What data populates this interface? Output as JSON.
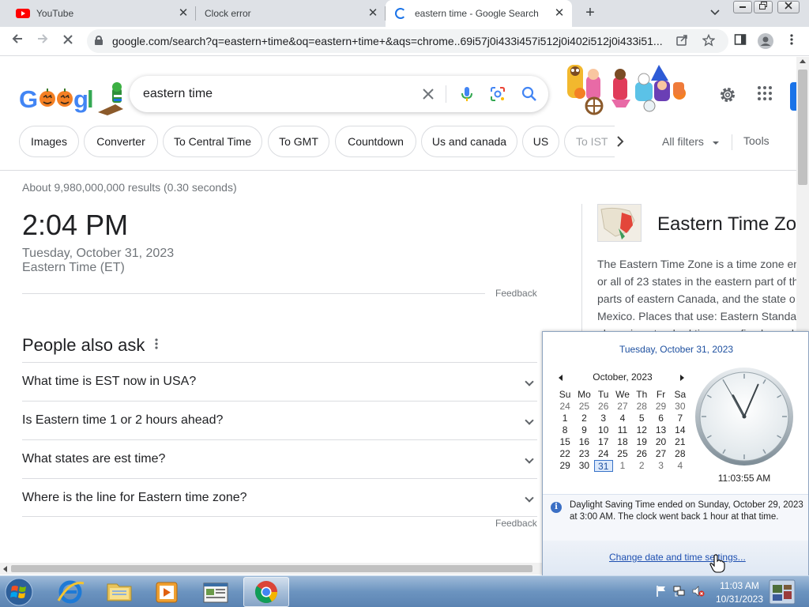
{
  "browser": {
    "tabs": [
      {
        "title": "YouTube",
        "icon": "youtube-icon"
      },
      {
        "title": "Clock error",
        "icon": "none"
      },
      {
        "title": "eastern time - Google Search",
        "icon": "loading-spinner-icon",
        "active": true
      }
    ],
    "new_tab_symbol": "+",
    "close_symbol": "✕",
    "url": "google.com/search?q=eastern+time&oq=eastern+time+&aqs=chrome..69i57j0i433i457i512j0i402i512j0i433i51..."
  },
  "search": {
    "query": "eastern time",
    "chips": [
      "Images",
      "Converter",
      "To Central Time",
      "To GMT",
      "Countdown",
      "Us and canada",
      "US",
      "To IST"
    ],
    "all_filters": "All filters",
    "tools": "Tools"
  },
  "results": {
    "stats": "About 9,980,000,000 results (0.30 seconds)",
    "time": "2:04 PM",
    "date": "Tuesday, October 31, 2023",
    "timezone": "Eastern Time (ET)",
    "feedback": "Feedback",
    "people_also_ask_title": "People also ask",
    "paa": [
      "What time is EST now in USA?",
      "Is Eastern time 1 or 2 hours ahead?",
      "What states are est time?",
      "Where is the line for Eastern time zone?"
    ],
    "feedback_2": "Feedback"
  },
  "knowledge_panel": {
    "title": "Eastern Time Zo",
    "description": [
      "The Eastern Time Zone is a time zone en",
      "or all of 23 states in the eastern part of th",
      "parts of eastern Canada, and the state o",
      "Mexico. Places that use: Eastern Standa",
      "observing standard time, are five hours b"
    ]
  },
  "clock_flyout": {
    "long_date": "Tuesday, October 31, 2023",
    "month_label": "October, 2023",
    "weekdays": [
      "Su",
      "Mo",
      "Tu",
      "We",
      "Th",
      "Fr",
      "Sa"
    ],
    "weeks": [
      [
        "24",
        "25",
        "26",
        "27",
        "28",
        "29",
        "30"
      ],
      [
        "1",
        "2",
        "3",
        "4",
        "5",
        "6",
        "7"
      ],
      [
        "8",
        "9",
        "10",
        "11",
        "12",
        "13",
        "14"
      ],
      [
        "15",
        "16",
        "17",
        "18",
        "19",
        "20",
        "21"
      ],
      [
        "22",
        "23",
        "24",
        "25",
        "26",
        "27",
        "28"
      ],
      [
        "29",
        "30",
        "31",
        "1",
        "2",
        "3",
        "4"
      ]
    ],
    "today": "31",
    "digital_time": "11:03:55 AM",
    "analog": {
      "hour": 11,
      "minute": 3,
      "second": 55
    },
    "dst_message": "Daylight Saving Time ended on Sunday, October 29, 2023 at 3:00 AM. The clock went back 1 hour at that time.",
    "settings_link": "Change date and time settings..."
  },
  "taskbar": {
    "time": "11:03 AM",
    "date": "10/31/2023"
  },
  "colors": {
    "accent": "#1a73e8",
    "link": "#1e4fb0"
  }
}
